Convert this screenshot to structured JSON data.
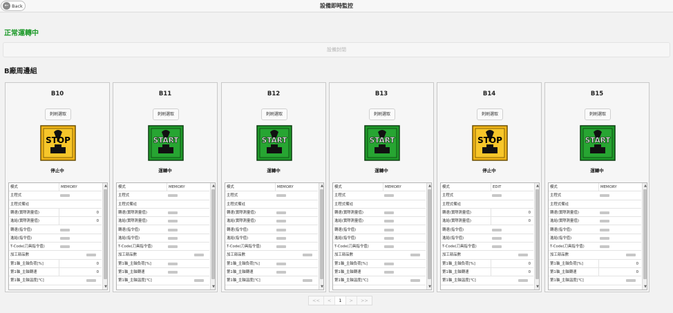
{
  "header": {
    "back_label": "Back",
    "title": "設備即時監控"
  },
  "status": {
    "text": "正常運轉中",
    "color": "#1e9a2a"
  },
  "close_button": {
    "label": "設備封閉"
  },
  "group": {
    "title": "B廠周邊組"
  },
  "colors": {
    "start_green": "#1f9a2a",
    "stop_yellow": "#f3b617"
  },
  "machines": [
    {
      "name": "B10",
      "button_label": "刺刷選取",
      "sign_text": "STOP",
      "sign_icon": "stop-sign-icon",
      "state_text": "停止中",
      "props": [
        {
          "name": "模式",
          "value": "MEMORY"
        },
        {
          "name": "主程式",
          "value": ""
        },
        {
          "name": "主程式備註",
          "value": ""
        },
        {
          "name": "轉速(實際測量值)",
          "value": "0"
        },
        {
          "name": "進給(實際測量值)",
          "value": "0"
        },
        {
          "name": "轉速(指令值)",
          "value": ""
        },
        {
          "name": "進給(指令值)",
          "value": ""
        },
        {
          "name": "T-Code(刀具指令值)",
          "value": ""
        },
        {
          "name": "加工部品數",
          "value": ""
        },
        {
          "name": "第1軸_主軸負荷[%]",
          "value": "0"
        },
        {
          "name": "第1軸_主軸轉速",
          "value": "0"
        },
        {
          "name": "第1軸_主軸溫度[℃]",
          "value": ""
        }
      ]
    },
    {
      "name": "B11",
      "button_label": "刺刷選取",
      "sign_text": "START",
      "sign_icon": "start-sign-icon",
      "state_text": "運轉中",
      "props": [
        {
          "name": "模式",
          "value": "MEMORY"
        },
        {
          "name": "主程式",
          "value": ""
        },
        {
          "name": "主程式備註",
          "value": ""
        },
        {
          "name": "轉速(實際測量值)",
          "value": ""
        },
        {
          "name": "進給(實際測量值)",
          "value": ""
        },
        {
          "name": "轉速(指令值)",
          "value": ""
        },
        {
          "name": "進給(指令值)",
          "value": ""
        },
        {
          "name": "T-Code(刀具指令值)",
          "value": ""
        },
        {
          "name": "加工部品數",
          "value": ""
        },
        {
          "name": "第1軸_主軸負荷[%]",
          "value": ""
        },
        {
          "name": "第1軸_主軸轉速",
          "value": ""
        },
        {
          "name": "第1軸_主軸溫度[℃]",
          "value": ""
        }
      ]
    },
    {
      "name": "B12",
      "button_label": "刺刷選取",
      "sign_text": "START",
      "sign_icon": "start-sign-icon",
      "state_text": "運轉中",
      "props": [
        {
          "name": "模式",
          "value": "MEMORY"
        },
        {
          "name": "主程式",
          "value": ""
        },
        {
          "name": "主程式備註",
          "value": ""
        },
        {
          "name": "轉速(實際測量值)",
          "value": ""
        },
        {
          "name": "進給(實際測量值)",
          "value": ""
        },
        {
          "name": "轉速(指令值)",
          "value": ""
        },
        {
          "name": "進給(指令值)",
          "value": ""
        },
        {
          "name": "T-Code(刀具指令值)",
          "value": ""
        },
        {
          "name": "加工部品數",
          "value": ""
        },
        {
          "name": "第1軸_主軸負荷[%]",
          "value": ""
        },
        {
          "name": "第1軸_主軸轉速",
          "value": ""
        },
        {
          "name": "第1軸_主軸溫度[℃]",
          "value": ""
        }
      ]
    },
    {
      "name": "B13",
      "button_label": "刺刷選取",
      "sign_text": "START",
      "sign_icon": "start-sign-icon",
      "state_text": "運轉中",
      "props": [
        {
          "name": "模式",
          "value": "MEMORY"
        },
        {
          "name": "主程式",
          "value": ""
        },
        {
          "name": "主程式備註",
          "value": ""
        },
        {
          "name": "轉速(實際測量值)",
          "value": ""
        },
        {
          "name": "進給(實際測量值)",
          "value": ""
        },
        {
          "name": "轉速(指令值)",
          "value": ""
        },
        {
          "name": "進給(指令值)",
          "value": ""
        },
        {
          "name": "T-Code(刀具指令值)",
          "value": ""
        },
        {
          "name": "加工部品數",
          "value": ""
        },
        {
          "name": "第1軸_主軸負荷[%]",
          "value": ""
        },
        {
          "name": "第1軸_主軸轉速",
          "value": ""
        },
        {
          "name": "第1軸_主軸溫度[℃]",
          "value": ""
        }
      ]
    },
    {
      "name": "B14",
      "button_label": "刺刷選取",
      "sign_text": "STOP",
      "sign_icon": "stop-sign-icon",
      "state_text": "停止中",
      "props": [
        {
          "name": "模式",
          "value": "EDIT"
        },
        {
          "name": "主程式",
          "value": ""
        },
        {
          "name": "主程式備註",
          "value": ""
        },
        {
          "name": "轉速(實際測量值)",
          "value": "0"
        },
        {
          "name": "進給(實際測量值)",
          "value": "0"
        },
        {
          "name": "轉速(指令值)",
          "value": ""
        },
        {
          "name": "進給(指令值)",
          "value": ""
        },
        {
          "name": "T-Code(刀具指令值)",
          "value": ""
        },
        {
          "name": "加工部品數",
          "value": ""
        },
        {
          "name": "第1軸_主軸負荷[%]",
          "value": "0"
        },
        {
          "name": "第1軸_主軸轉速",
          "value": "0"
        },
        {
          "name": "第1軸_主軸溫度[℃]",
          "value": ""
        }
      ]
    },
    {
      "name": "B15",
      "button_label": "刺刷選取",
      "sign_text": "START",
      "sign_icon": "start-sign-icon",
      "state_text": "運轉中",
      "props": [
        {
          "name": "模式",
          "value": "MEMORY"
        },
        {
          "name": "主程式",
          "value": ""
        },
        {
          "name": "主程式備註",
          "value": ""
        },
        {
          "name": "轉速(實際測量值)",
          "value": ""
        },
        {
          "name": "進給(實際測量值)",
          "value": ""
        },
        {
          "name": "轉速(指令值)",
          "value": ""
        },
        {
          "name": "進給(指令值)",
          "value": ""
        },
        {
          "name": "T-Code(刀具指令值)",
          "value": ""
        },
        {
          "name": "加工部品數",
          "value": ""
        },
        {
          "name": "第1軸_主軸負荷[%]",
          "value": "0"
        },
        {
          "name": "第1軸_主軸轉速",
          "value": "0"
        },
        {
          "name": "第1軸_主軸溫度[℃]",
          "value": ""
        }
      ]
    }
  ],
  "pagination": {
    "first": "<<",
    "prev": "<",
    "current": "1",
    "next": ">",
    "last": ">>"
  }
}
